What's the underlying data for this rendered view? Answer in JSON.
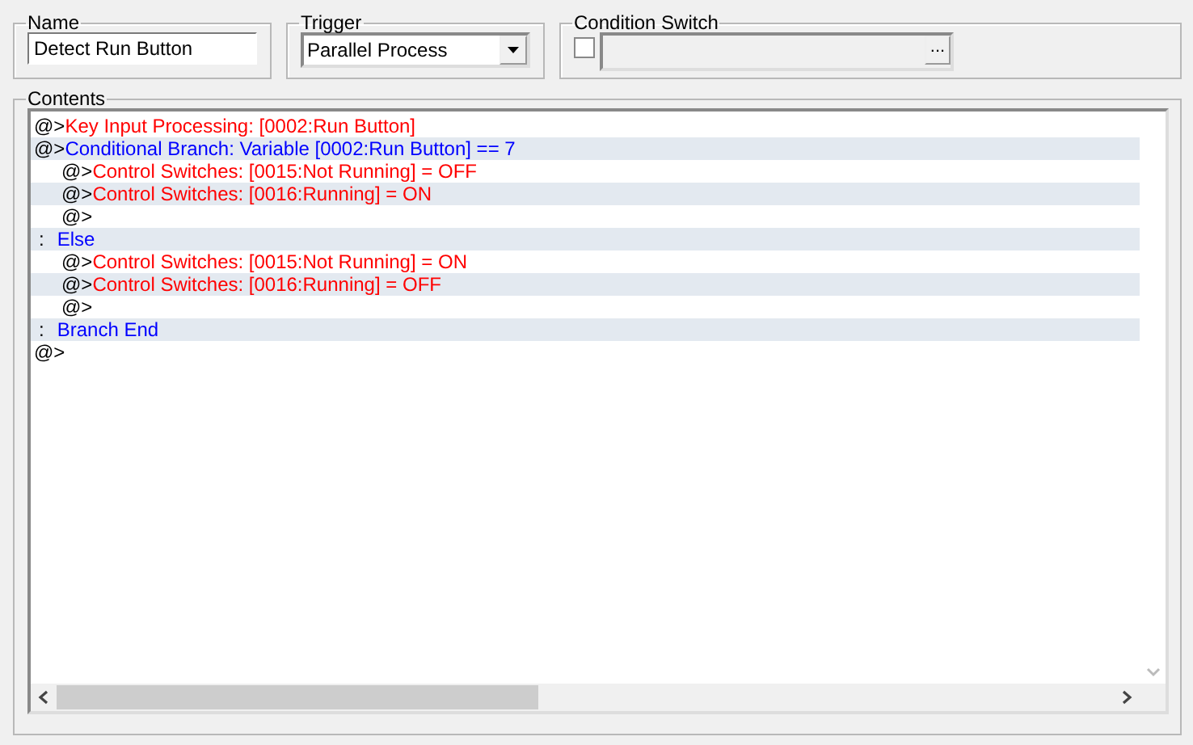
{
  "name": {
    "label": "Name",
    "value": "Detect Run Button"
  },
  "trigger": {
    "label": "Trigger",
    "value": "Parallel Process"
  },
  "condition_switch": {
    "label": "Condition Switch",
    "checked": false,
    "browse_label": "..."
  },
  "contents": {
    "label": "Contents",
    "lines": [
      {
        "prefix": "@>",
        "text": "Key Input Processing: [0002:Run Button]",
        "kind": "command"
      },
      {
        "prefix": "@>",
        "text": "Conditional Branch: Variable [0002:Run Button] == 7",
        "kind": "branch",
        "children": [
          {
            "prefix": "@>",
            "text": "Control Switches: [0015:Not Running] = OFF",
            "kind": "command"
          },
          {
            "prefix": "@>",
            "text": "Control Switches: [0016:Running] = ON",
            "kind": "command"
          },
          {
            "prefix": "@>",
            "kind": "empty"
          }
        ]
      },
      {
        "prefix": ":",
        "text": "Else",
        "kind": "label",
        "children": [
          {
            "prefix": "@>",
            "text": "Control Switches: [0015:Not Running] = ON",
            "kind": "command"
          },
          {
            "prefix": "@>",
            "text": "Control Switches: [0016:Running] = OFF",
            "kind": "command"
          },
          {
            "prefix": "@>",
            "kind": "empty"
          }
        ]
      },
      {
        "prefix": ":",
        "text": "Branch End",
        "kind": "label"
      },
      {
        "prefix": "@>",
        "kind": "empty"
      }
    ]
  }
}
